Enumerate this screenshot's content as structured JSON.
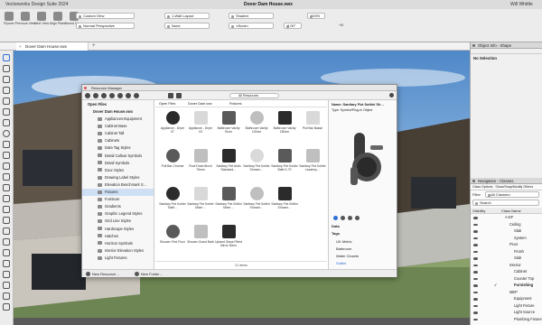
{
  "app_title": "Vectorworks Design Suite 2024",
  "window_title": "Dover Dam House.vwx",
  "user": "Will Whittle",
  "toolbar": {
    "buttons": [
      {
        "label": "Flyover"
      },
      {
        "label": "Previous View"
      },
      {
        "label": "Next View"
      },
      {
        "label": "Align Plane"
      },
      {
        "label": "Saved Views"
      }
    ],
    "view": "Custom View",
    "projection": "Normal Perspective",
    "layout": "1-Wall Layout",
    "render": "Shaded",
    "class": "None",
    "render2": "<None>",
    "zoom": "100%",
    "angle": "0.00°",
    "tag": "+B"
  },
  "doc_tab": {
    "label": "Dover Dam House.vwx"
  },
  "resource_manager": {
    "title": "Resource Manager",
    "search_placeholder": "All Resources",
    "tree_header": "Open Files",
    "file": "Dover Dam House.vwx",
    "folders": [
      "Appliances-Equipment",
      "Cabinet Base",
      "Cabinet Tall",
      "Cabinets",
      "Data Tag Styles",
      "Detail Callout Symbols",
      "Detail Symbols",
      "Door Styles",
      "Drawing Label Styles",
      "Elevation Benchmark S…",
      "Fixtures",
      "Furniture",
      "Gradients",
      "Graphic Legend Styles",
      "Grid Line Styles",
      "Hardscape Styles",
      "Hatches",
      "Horizon Symbols",
      "Interior Elevation Styles",
      "Light Fixtures"
    ],
    "selected_folder": "Fixtures",
    "breadcrumb": [
      "Open Files",
      "Dover Dam.vwx",
      "Fixtures"
    ],
    "items": [
      "Appliance - Dryer 07",
      "Appliance - Dryer 03",
      "Bathroom Vanity 91cm",
      "Bathroom Vanity 100cm",
      "Bathroom Vanity 180cm",
      "Pull Bar Basse",
      "Pull Bar Chrome",
      "Roof Drain 8Inch 76mm",
      "Sanitary Fixt Ardis Standard…",
      "Sanitary Fixt Kohler Shower…",
      "Sanitary Fixt Kohler Bath K-70",
      "Sanitary Fixt Kohler Lavatory…",
      "Sanitary Fixt Kohler Toilet…",
      "Sanitary Fixt Kohler Mixer…",
      "Sanitary Fixt Sottini Mixer…",
      "Sanitary Fixt Sottini Shower…",
      "Sanitary Fixt Sottini Shower…",
      "",
      "Shower-First Floor",
      "Shower-Guest Bath",
      "Upland Glass Fitted Mirror 80cm"
    ],
    "item_count": "21 items",
    "preview_title": "Name: Sanitary Fixt Sottini Sh…",
    "preview_type": "Type: Symbol/Plug-in Object",
    "data_label": "Data",
    "tags_label": "Tags",
    "tags": [
      "UK Metric",
      "Bathroom",
      "Water Closets",
      "Sottini"
    ],
    "new_resource": "New Resource…",
    "new_folder": "New Folder…"
  },
  "object_info": {
    "title": "Object Info - Shape",
    "status": "No Selection"
  },
  "navigation": {
    "title": "Navigation - Classes",
    "tabs": [
      "Class Options",
      "Show/Snap/Modify Others"
    ],
    "filter_label": "Filter",
    "filter_value": "<All Classes>",
    "search_placeholder": "Search",
    "col_visibility": "Visibility",
    "col_name": "Class Name",
    "rows": [
      {
        "name": "A-EF",
        "indent": 0
      },
      {
        "name": "Ceiling",
        "indent": 1
      },
      {
        "name": "Slab",
        "indent": 2
      },
      {
        "name": "System",
        "indent": 2
      },
      {
        "name": "Floor",
        "indent": 1
      },
      {
        "name": "Finish",
        "indent": 2
      },
      {
        "name": "Slab",
        "indent": 2
      },
      {
        "name": "Interior",
        "indent": 1
      },
      {
        "name": "Cabinet",
        "indent": 2
      },
      {
        "name": "Counter Top",
        "indent": 2
      },
      {
        "name": "Furnishing",
        "indent": 2,
        "active": true
      },
      {
        "name": "MEP",
        "indent": 1
      },
      {
        "name": "Equipment",
        "indent": 2
      },
      {
        "name": "Light Fixture",
        "indent": 2
      },
      {
        "name": "Light Source",
        "indent": 2
      },
      {
        "name": "Plumbing Fixture",
        "indent": 2
      }
    ]
  },
  "colors": {
    "accent": "#2f6fd6",
    "selection": "#cfe0f5",
    "toolbar": "#ececec"
  }
}
